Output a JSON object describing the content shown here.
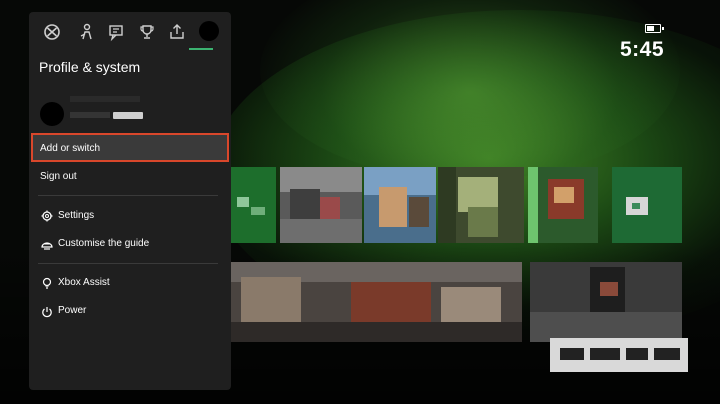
{
  "status": {
    "time": "5:45"
  },
  "guide": {
    "tabs": [
      "xbox-logo-icon",
      "people-icon",
      "chat-icon",
      "trophy-icon",
      "share-icon",
      "profile-avatar-icon"
    ],
    "title": "Profile & system",
    "profile": {
      "badge": "ULTIMATE"
    },
    "menu": {
      "add_or_switch": "Add or switch",
      "sign_out": "Sign out",
      "settings": "Settings",
      "customise_guide": "Customise the guide",
      "xbox_assist": "Xbox Assist",
      "power": "Power"
    },
    "selected_item": "add_or_switch",
    "colors": {
      "panel": "#1f1f1f",
      "highlight_border": "#d9472b",
      "accent": "#3cb371"
    }
  }
}
